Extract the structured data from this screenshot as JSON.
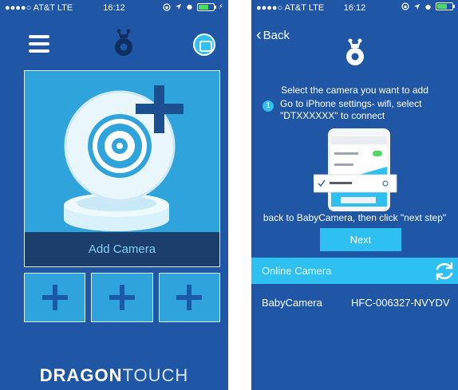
{
  "status": {
    "carrier": "●●●●○ AT&T  LTE",
    "time": "16:12"
  },
  "home": {
    "add_camera_label": "Add Camera",
    "brand_bold": "DRAGON",
    "brand_light": "TOUCH"
  },
  "add": {
    "back_label": "Back",
    "select_title": "Select the camera you want to add",
    "step_number": "1",
    "step_text": "Go to iPhone settings- wifi, select \"DTXXXXXX\" to connect",
    "back_instruction": "back to BabyCamera, then click \"next step\"",
    "next_label": "Next",
    "online_camera_label": "Online Camera",
    "camera": {
      "name": "BabyCamera",
      "id": "HFC-006327-NVYDV"
    }
  },
  "colors": {
    "background": "#1f56a5",
    "accent": "#2ec0f0",
    "card": "#2ea3dc",
    "label_bar": "#1b3e6c"
  },
  "icons": [
    "menu-icon",
    "robot-logo-icon",
    "message-icon",
    "camera-add-icon",
    "plus-icon",
    "chevron-left-icon",
    "refresh-icon"
  ]
}
